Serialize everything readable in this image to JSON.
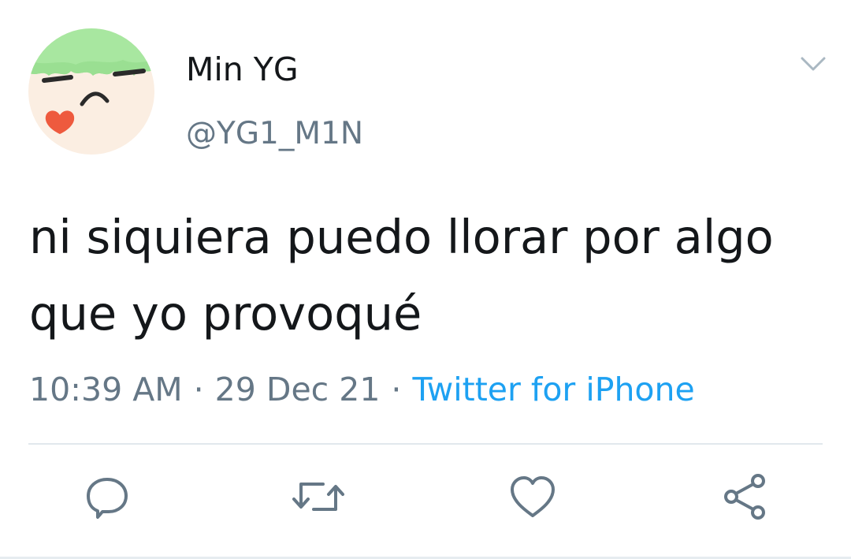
{
  "author": {
    "display_name": "Min YG",
    "handle": "@YG1_M1N"
  },
  "tweet": {
    "text": "ni siquiera puedo llorar por algo que yo provoqué",
    "time": "10:39 AM",
    "date": "29 Dec 21",
    "separator": "·",
    "source": "Twitter for iPhone"
  },
  "icons": {
    "menu": "chevron-down-icon",
    "reply": "reply-icon",
    "retweet": "retweet-icon",
    "like": "heart-icon",
    "share": "share-icon"
  },
  "colors": {
    "text": "#14171a",
    "secondary": "#657786",
    "link": "#1da1f2",
    "divider": "#e1e8ed"
  }
}
